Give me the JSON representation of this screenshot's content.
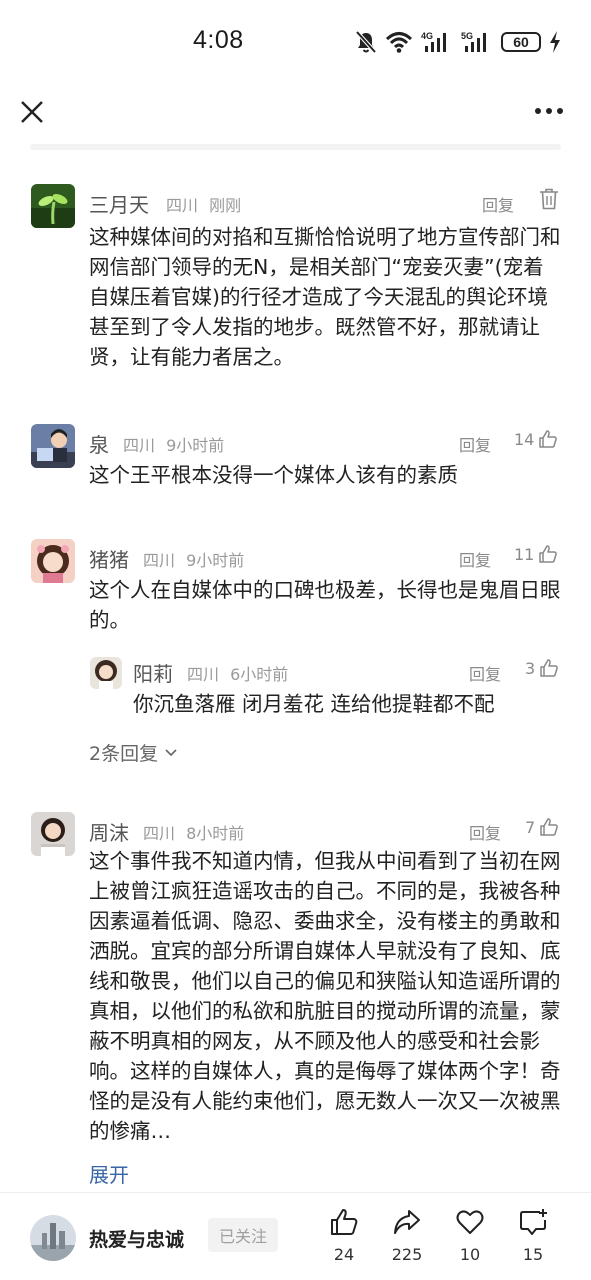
{
  "status_bar": {
    "time": "4:08",
    "battery": "60",
    "network_1": "4G",
    "network_2": "5G"
  },
  "comments": [
    {
      "name": "三月天",
      "location": "四川",
      "time": "刚刚",
      "reply_label": "回复",
      "text": "这种媒体间的对掐和互撕恰恰说明了地方宣传部门和网信部门领导的无N，是相关部门“宠妾灭妻”(宠着自媒压着官媒)的行径才造成了今天混乱的舆论环境甚至到了令人发指的地步。既然管不好，那就请让贤，让有能力者居之。"
    },
    {
      "name": "泉",
      "location": "四川",
      "time": "9小时前",
      "reply_label": "回复",
      "likes": "14",
      "text": "这个王平根本没得一个媒体人该有的素质"
    },
    {
      "name": "猪猪",
      "location": "四川",
      "time": "9小时前",
      "reply_label": "回复",
      "likes": "11",
      "text": "这个人在自媒体中的口碑也极差，长得也是鬼眉日眼的。",
      "reply": {
        "name": "阳莉",
        "location": "四川",
        "time": "6小时前",
        "reply_label": "回复",
        "likes": "3",
        "text": "你沉鱼落雁 闭月羞花 连给他提鞋都不配"
      },
      "more_replies": "2条回复"
    },
    {
      "name": "周沫",
      "location": "四川",
      "time": "8小时前",
      "reply_label": "回复",
      "likes": "7",
      "text": "这个事件我不知道内情，但我从中间看到了当初在网上被曾江疯狂造谣攻击的自己。不同的是，我被各种因素逼着低调、隐忍、委曲求全，没有楼主的勇敢和洒脱。宜宾的部分所谓自媒体人早就没有了良知、底线和敬畏，他们以自己的偏见和狭隘认知造谣所谓的真相，以他们的私欲和肮脏目的搅动所谓的流量，蒙蔽不明真相的网友，从不顾及他人的感受和社会影响。这样的自媒体人，真的是侮辱了媒体两个字！奇怪的是没有人能约束他们，愿无数人一次又一次被黑的惨痛…",
      "expand_label": "展开"
    }
  ],
  "bottom_bar": {
    "author_name": "热爱与忠诚",
    "follow_label": "已关注",
    "likes": "24",
    "shares": "225",
    "favorites": "10",
    "comments": "15"
  }
}
